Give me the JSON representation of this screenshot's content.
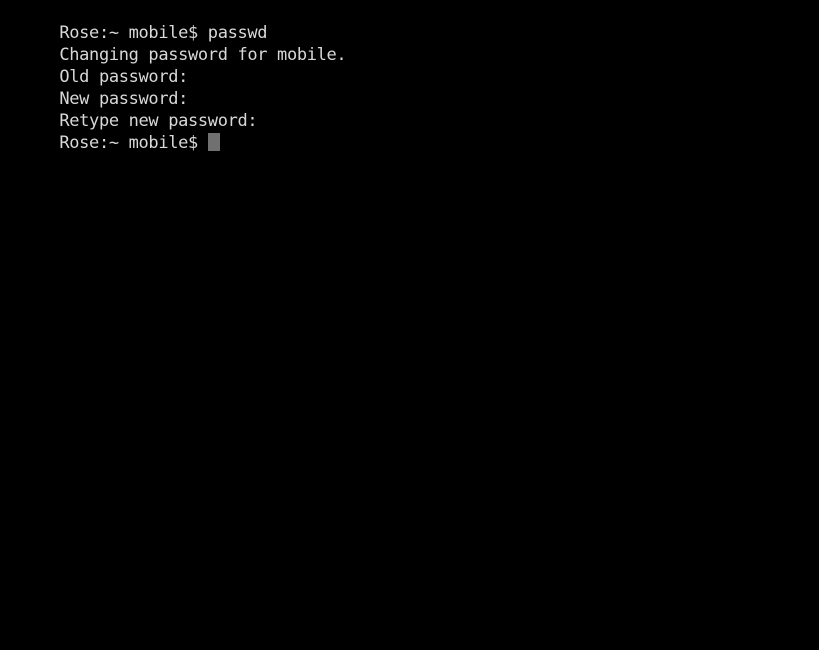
{
  "terminal": {
    "background_color": "#000000",
    "foreground_color": "#d8d8d8",
    "cursor_color": "#707070",
    "cursor_style": "block",
    "lines": [
      {
        "text": "Rose:~ mobile$ passwd",
        "has_cursor": false
      },
      {
        "text": "Changing password for mobile.",
        "has_cursor": false
      },
      {
        "text": "Old password:",
        "has_cursor": false
      },
      {
        "text": "New password:",
        "has_cursor": false
      },
      {
        "text": "Retype new password:",
        "has_cursor": false
      },
      {
        "text": "Rose:~ mobile$ ",
        "has_cursor": true
      }
    ],
    "session": {
      "hostname": "Rose",
      "working_directory": "~",
      "username": "mobile",
      "prompt_symbol": "$",
      "prompt": "Rose:~ mobile$",
      "command": "passwd"
    }
  }
}
